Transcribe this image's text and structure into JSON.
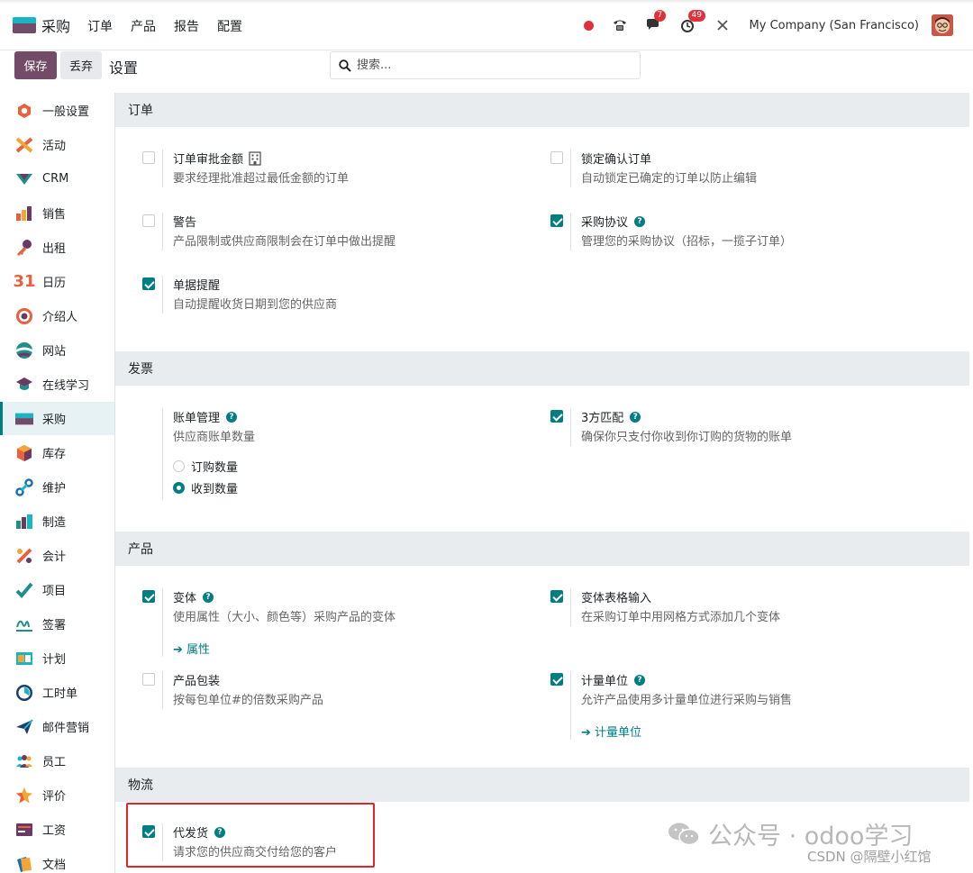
{
  "app": {
    "name": "采购"
  },
  "topmenu": [
    "订单",
    "产品",
    "报告",
    "配置"
  ],
  "systray": {
    "chat_badge": "7",
    "activity_badge": "49",
    "company": "My Company (San Francisco)"
  },
  "control": {
    "save_label": "保存",
    "discard_label": "丢弃",
    "title": "设置",
    "search_placeholder": "搜索..."
  },
  "sidebar": {
    "items": [
      {
        "label": "一般设置",
        "icon": "settings-icon"
      },
      {
        "label": "活动",
        "icon": "event-icon"
      },
      {
        "label": "CRM",
        "icon": "crm-icon"
      },
      {
        "label": "销售",
        "icon": "sales-icon"
      },
      {
        "label": "出租",
        "icon": "rental-icon"
      },
      {
        "label": "日历",
        "icon": "calendar-icon"
      },
      {
        "label": "介绍人",
        "icon": "referral-icon"
      },
      {
        "label": "网站",
        "icon": "website-icon"
      },
      {
        "label": "在线学习",
        "icon": "elearning-icon"
      },
      {
        "label": "采购",
        "icon": "purchase-icon",
        "active": true
      },
      {
        "label": "库存",
        "icon": "inventory-icon"
      },
      {
        "label": "维护",
        "icon": "maintenance-icon"
      },
      {
        "label": "制造",
        "icon": "manufacturing-icon"
      },
      {
        "label": "会计",
        "icon": "accounting-icon"
      },
      {
        "label": "项目",
        "icon": "project-icon"
      },
      {
        "label": "签署",
        "icon": "sign-icon"
      },
      {
        "label": "计划",
        "icon": "planning-icon"
      },
      {
        "label": "工时单",
        "icon": "timesheet-icon"
      },
      {
        "label": "邮件营销",
        "icon": "email-marketing-icon"
      },
      {
        "label": "员工",
        "icon": "employees-icon"
      },
      {
        "label": "评价",
        "icon": "appraisal-icon"
      },
      {
        "label": "工资",
        "icon": "payroll-icon"
      },
      {
        "label": "文档",
        "icon": "documents-icon"
      }
    ]
  },
  "sections": {
    "orders": {
      "title": "订单",
      "approval": {
        "label": "订单审批金额",
        "desc": "要求经理批准超过最低金额的订单",
        "checked": false
      },
      "lock": {
        "label": "锁定确认订单",
        "desc": "自动锁定已确定的订单以防止编辑",
        "checked": false
      },
      "warning": {
        "label": "警告",
        "desc": "产品限制或供应商限制会在订单中做出提醒",
        "checked": false
      },
      "agreements": {
        "label": "采购协议",
        "desc": "管理您的采购协议（招标，一揽子订单）",
        "checked": true
      },
      "reminder": {
        "label": "单据提醒",
        "desc": "自动提醒收货日期到您的供应商",
        "checked": true
      }
    },
    "invoicing": {
      "title": "发票",
      "bill": {
        "label": "账单管理",
        "desc": "供应商账单数量",
        "options": [
          "订购数量",
          "收到数量"
        ],
        "selected": "收到数量"
      },
      "match": {
        "label": "3方匹配",
        "desc": "确保你只支付你收到你订购的货物的账单",
        "checked": true
      }
    },
    "products": {
      "title": "产品",
      "variants": {
        "label": "变体",
        "desc": "使用属性（大小、颜色等）采购产品的变体",
        "link": "属性",
        "checked": true
      },
      "grid": {
        "label": "变体表格输入",
        "desc": "在采购订单中用网格方式添加几个变体",
        "checked": true
      },
      "packaging": {
        "label": "产品包装",
        "desc": "按每包单位#的倍数采购产品",
        "checked": false
      },
      "uom": {
        "label": "计量单位",
        "desc": "允许产品使用多计量单位进行采购与销售",
        "link": "计量单位",
        "checked": true
      }
    },
    "logistics": {
      "title": "物流",
      "dropship": {
        "label": "代发货",
        "desc": "请求您的供应商交付给您的客户",
        "checked": true
      }
    }
  },
  "watermark": {
    "main": "公众号 · odoo学习",
    "sub": "CSDN @隔壁小红馆"
  },
  "colors": {
    "primary": "#714b67",
    "accent": "#017e84",
    "badge": "#e0313b",
    "highlight": "#e0262b"
  }
}
